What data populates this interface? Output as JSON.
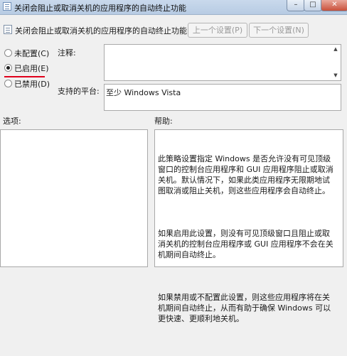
{
  "window": {
    "title": "关闭会阻止或取消关机的应用程序的自动终止功能",
    "min_glyph": "–",
    "max_glyph": "□",
    "close_glyph": "✕"
  },
  "header": {
    "title": "关闭会阻止或取消关机的应用程序的自动终止功能",
    "prev_label": "上一个设置(P)",
    "next_label": "下一个设置(N)"
  },
  "state": {
    "options": [
      {
        "label": "未配置(C)",
        "selected": false
      },
      {
        "label": "已启用(E)",
        "selected": true
      },
      {
        "label": "已禁用(D)",
        "selected": false
      }
    ]
  },
  "fields": {
    "comment_label": "注释:",
    "comment_value": "",
    "platform_label": "支持的平台:",
    "platform_value": "至少 Windows Vista"
  },
  "panels": {
    "options_label": "选项:",
    "help_label": "帮助:",
    "help_paragraphs": [
      "此策略设置指定 Windows 是否允许没有可见顶级窗口的控制台应用程序和 GUI 应用程序阻止或取消关机。默认情况下，如果此类应用程序无限期地试图取消或阻止关机，则这些应用程序会自动终止。",
      "如果启用此设置，则没有可见顶级窗口且阻止或取消关机的控制台应用程序或 GUI 应用程序不会在关机期间自动终止。",
      "如果禁用或不配置此设置，则这些应用程序将在关机期间自动终止，从而有助于确保 Windows 可以更快速、更顺利地关机。"
    ]
  },
  "colors": {
    "highlight_underline": "#e0001b"
  }
}
